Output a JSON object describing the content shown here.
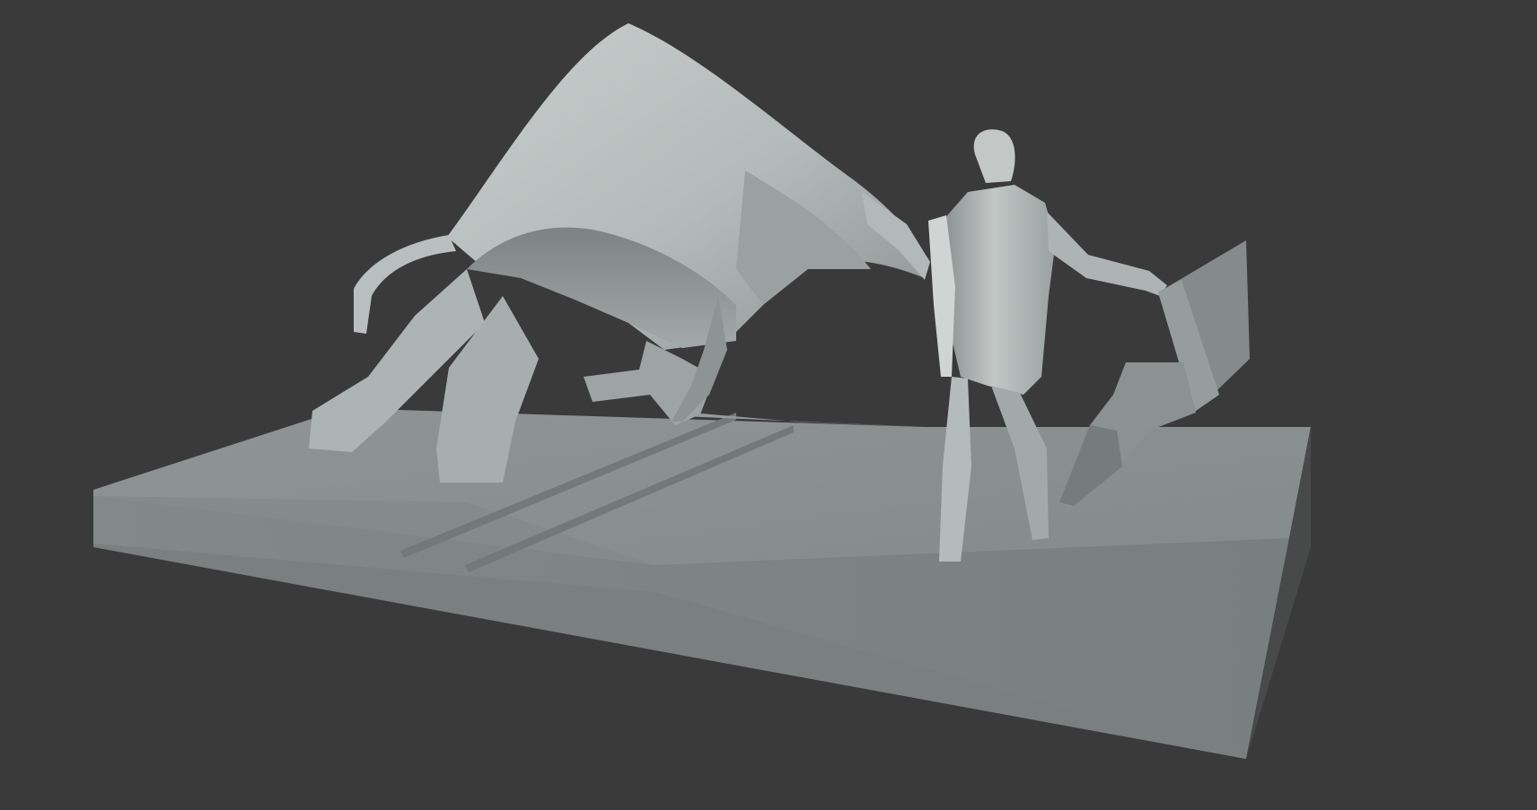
{
  "viewport": {
    "background_color": "#3a3a3a",
    "shading": "solid"
  },
  "scene": {
    "objects": [
      "base-plinth",
      "bull-sculpture",
      "matador-figure",
      "cape"
    ],
    "base_top_color": "#8a8f8f",
    "base_front_color": "#7e8484",
    "base_side_color": "#4a4c4c",
    "sculpture_light_color": "#c7cccb",
    "sculpture_mid_color": "#a4aaa9",
    "sculpture_dark_color": "#6f7574",
    "cape_color": "#8f9493"
  }
}
